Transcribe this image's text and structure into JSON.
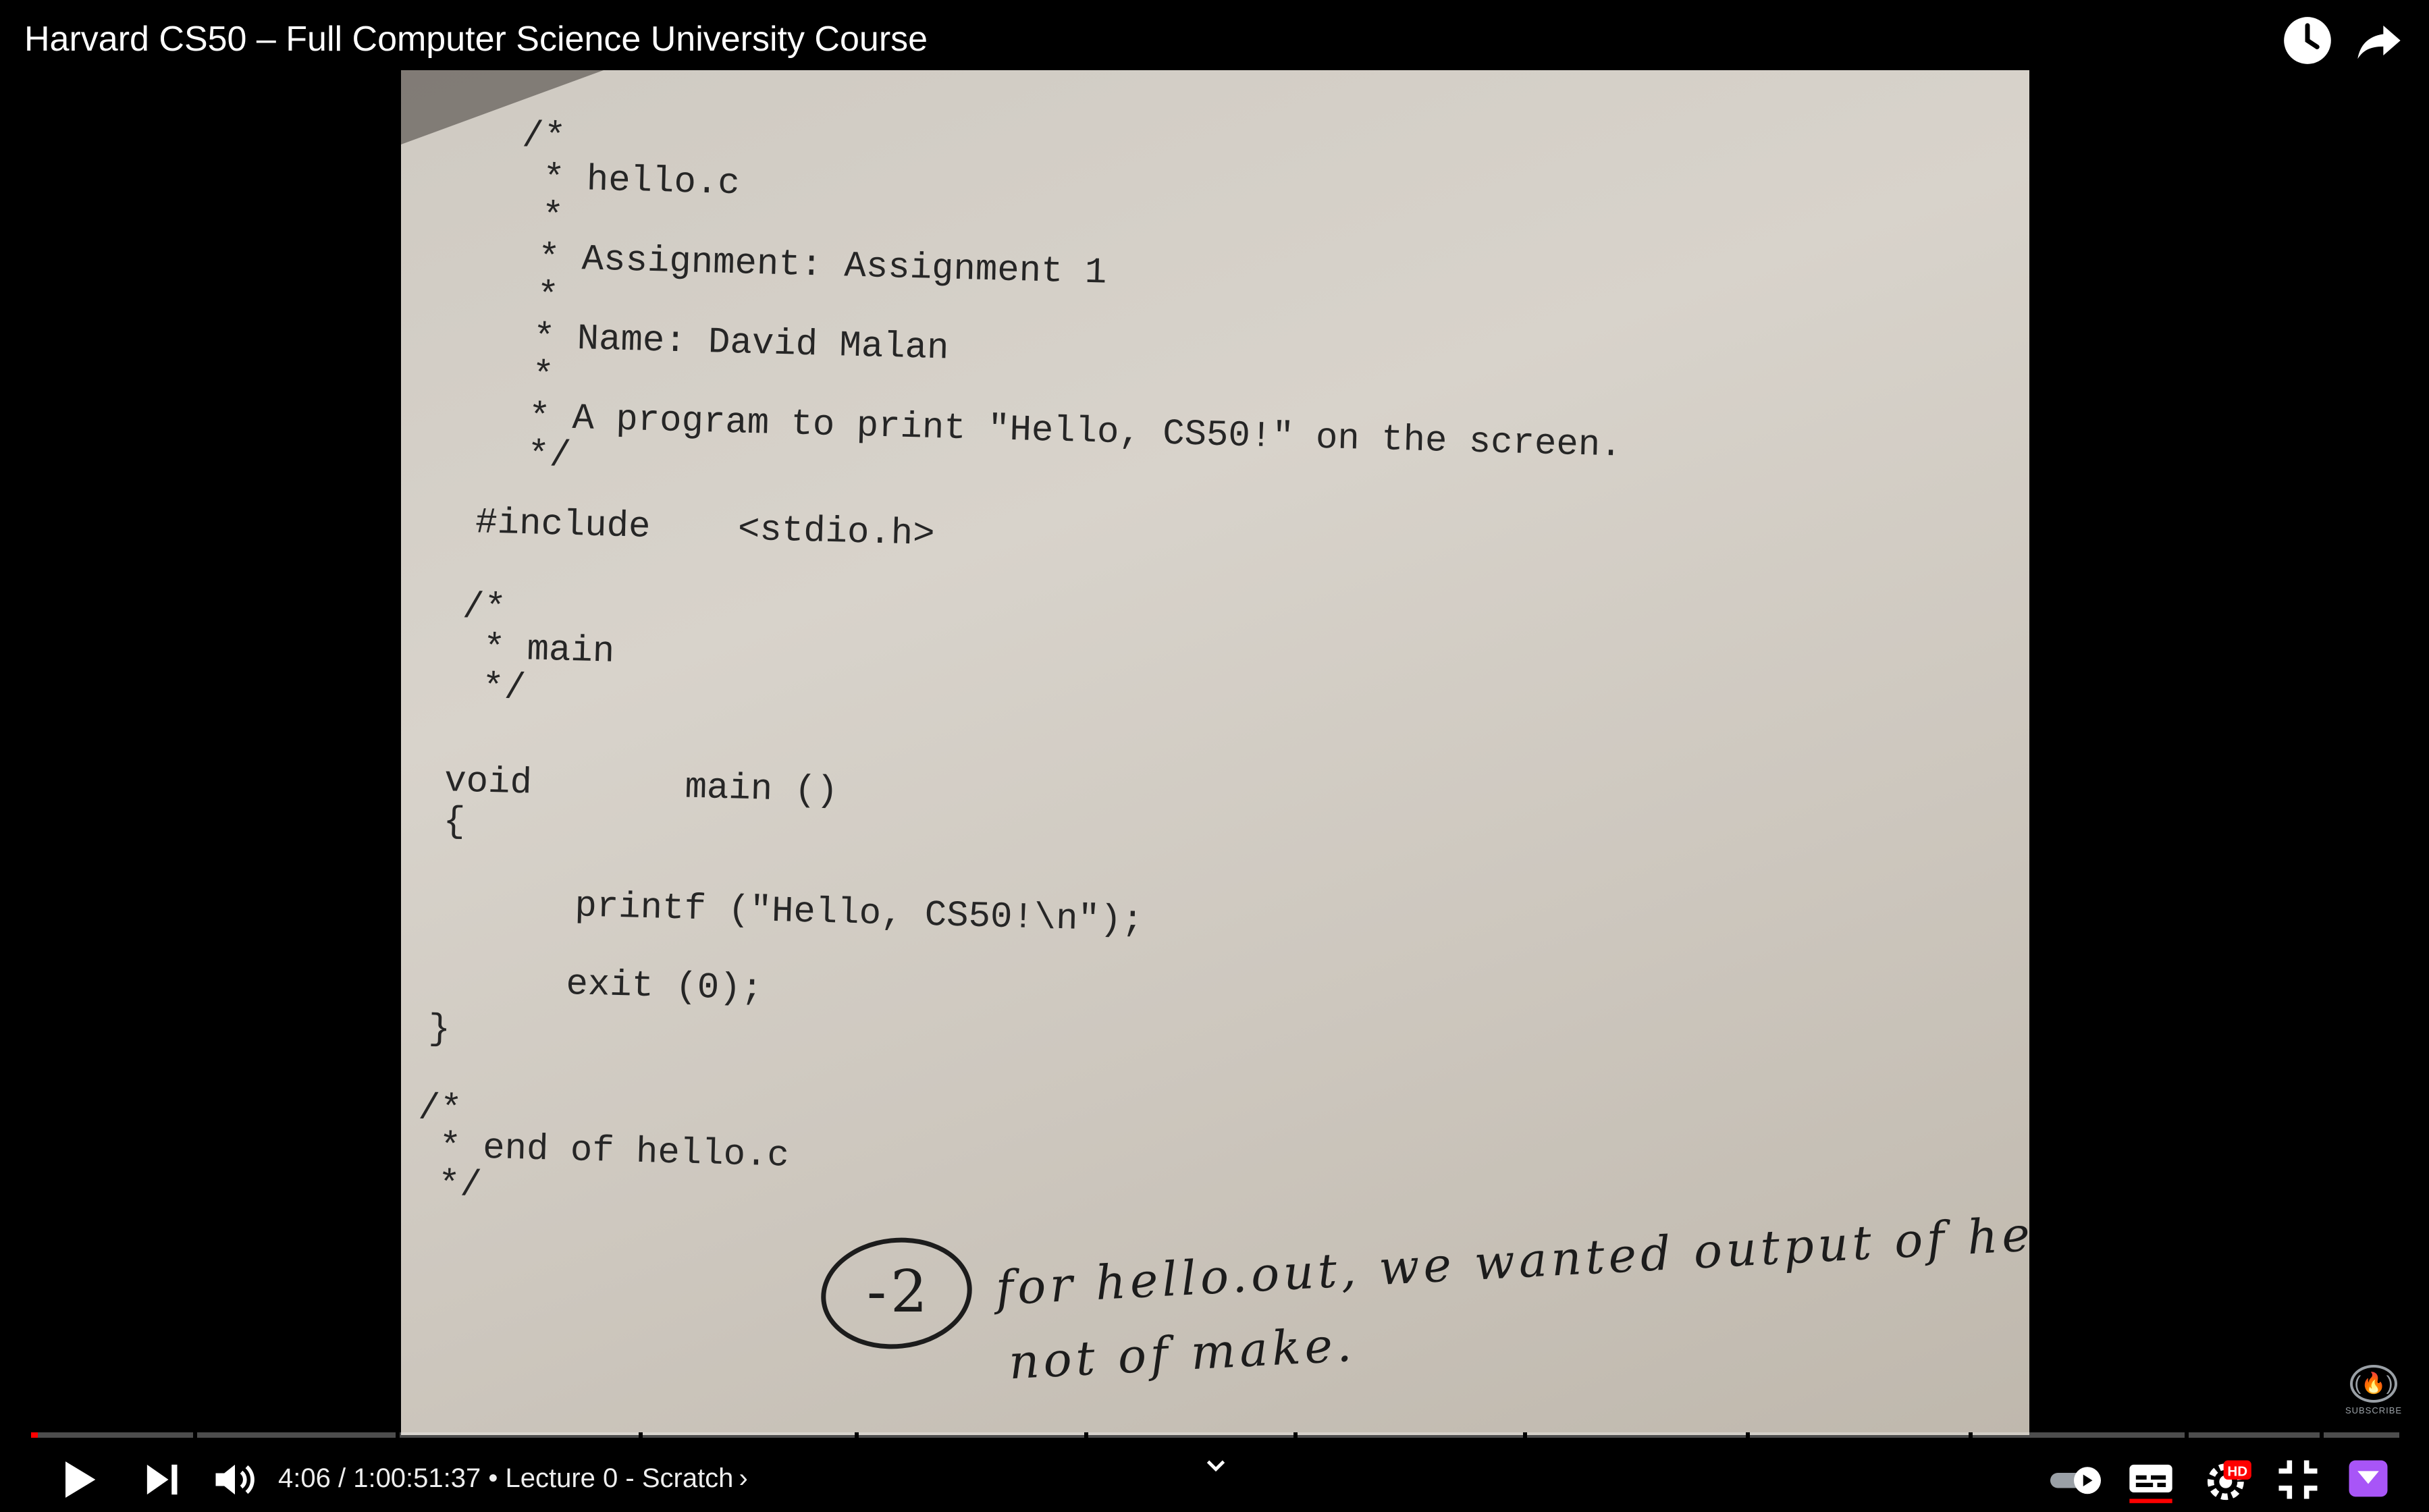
{
  "video_title": "Harvard CS50 – Full Computer Science University Course",
  "top_icons": [
    "watch-later-icon",
    "share-icon"
  ],
  "slide": {
    "code_lines": [
      "/*",
      " * hello.c",
      " *",
      " * Assignment: Assignment 1",
      " *",
      " * Name: David Malan",
      " *",
      " * A program to print \"Hello, CS50!\" on the screen.",
      " */",
      "#include    <stdio.h>",
      "/*",
      " * main",
      " */",
      "void       main ()",
      "{",
      "printf (\"Hello, CS50!\\n\");",
      "exit (0);",
      "}",
      "/*",
      " * end of hello.c",
      " */"
    ],
    "handwritten_score": "-2",
    "handwritten_note_line1": "for hello.out, we wanted output of hello,",
    "handwritten_note_line2": "not of make."
  },
  "subscribe_label": "SUBSCRIBE",
  "player": {
    "progress": 0.0011,
    "current_time": "4:06",
    "duration": "1:00:51:37",
    "separator": " / ",
    "bullet": " • ",
    "chapter": "Lecture 0 - Scratch",
    "chapter_arrow": "›",
    "hd_badge": "HD",
    "accent_color": "#ff0000"
  }
}
